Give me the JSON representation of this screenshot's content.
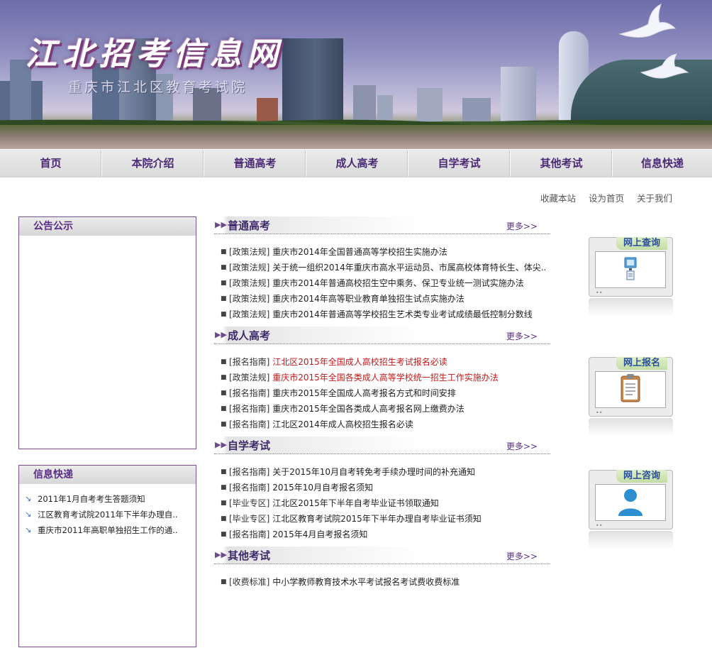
{
  "banner": {
    "title": "江北招考信息网",
    "subtitle": "重庆市江北区教育考试院"
  },
  "nav": {
    "items": [
      "首页",
      "本院介绍",
      "普通高考",
      "成人高考",
      "自学考试",
      "其他考试",
      "信息快递"
    ]
  },
  "top_links": [
    "收藏本站",
    "设为首页",
    "关于我们"
  ],
  "notice": {
    "title": "公告公示"
  },
  "news": {
    "title": "信息快递",
    "items": [
      "2011年1月自考考生答题须知",
      "江区教育考试院2011年下半年办理自..",
      "重庆市2011年高职单独招生工作的通.."
    ]
  },
  "sections": [
    {
      "title": "普通高考",
      "more": "更多>>",
      "items": [
        {
          "cat": "[政策法规]",
          "text": "重庆市2014年全国普通高等学校招生实施办法",
          "highlight": false
        },
        {
          "cat": "[政策法规]",
          "text": "关于统一组织2014年重庆市高水平运动员、市属高校体育特长生、体尖..",
          "highlight": false
        },
        {
          "cat": "[政策法规]",
          "text": "重庆市2014年普通高校招生空中乘务、保卫专业统一测试实施办法",
          "highlight": false
        },
        {
          "cat": "[政策法规]",
          "text": "重庆市2014年高等职业教育单独招生试点实施办法",
          "highlight": false
        },
        {
          "cat": "[政策法规]",
          "text": "重庆市2014年普通高等学校招生艺术类专业考试成绩最低控制分数线",
          "highlight": false
        }
      ]
    },
    {
      "title": "成人高考",
      "more": "更多>>",
      "items": [
        {
          "cat": "[报名指南]",
          "text": "江北区2015年全国成人高校招生考试报名必读",
          "highlight": true
        },
        {
          "cat": "[政策法规]",
          "text": "重庆市2015年全国各类成人高等学校统一招生工作实施办法",
          "highlight": true
        },
        {
          "cat": "[报名指南]",
          "text": "重庆市2015年全国成人高考报名方式和时间安排",
          "highlight": false
        },
        {
          "cat": "[报名指南]",
          "text": "重庆市2015年全国各类成人高考报名网上缴费办法",
          "highlight": false
        },
        {
          "cat": "[报名指南]",
          "text": "江北区2014年成人高校招生报名必读",
          "highlight": false
        }
      ]
    },
    {
      "title": "自学考试",
      "more": "更多>>",
      "items": [
        {
          "cat": "[报名指南]",
          "text": "关于2015年10月自考转免考手续办理时间的补充通知",
          "highlight": false
        },
        {
          "cat": "[报名指南]",
          "text": "2015年10月自考报名须知",
          "highlight": false
        },
        {
          "cat": "[毕业专区]",
          "text": "江北区2015年下半年自考毕业证书领取通知",
          "highlight": false
        },
        {
          "cat": "[毕业专区]",
          "text": "江北区教育考试院2015年下半年办理自考毕业证书须知",
          "highlight": false
        },
        {
          "cat": "[报名指南]",
          "text": "2015年4月自考报名须知",
          "highlight": false
        }
      ]
    },
    {
      "title": "其他考试",
      "more": "更多>>",
      "items": [
        {
          "cat": "[收费标准]",
          "text": "中小学教师教育技术水平考试报名考试费收费标准",
          "highlight": false
        }
      ]
    }
  ],
  "services": [
    {
      "label": "网上查询",
      "icon": "computer-icon"
    },
    {
      "label": "网上报名",
      "icon": "clipboard-icon"
    },
    {
      "label": "网上咨询",
      "icon": "user-icon"
    }
  ],
  "colors": {
    "nav_text": "#4b2a75",
    "panel_border": "#7b4d92",
    "highlight_red": "#c21a1a",
    "service_label": "#2a4f9a"
  }
}
